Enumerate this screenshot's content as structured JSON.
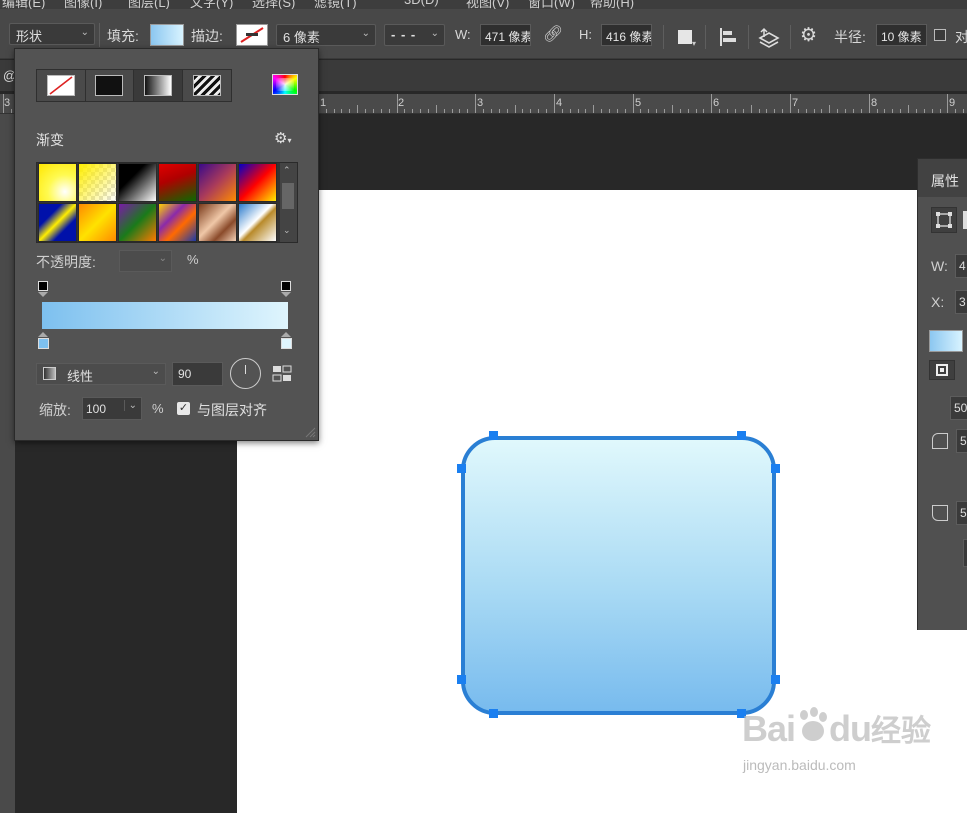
{
  "options_bar": {
    "tool_mode": "形状",
    "fill_label": "填充:",
    "stroke_label": "描边:",
    "stroke_width": "6 像素",
    "stroke_type": "- - -",
    "w_label": "W:",
    "w_value": "471 像素",
    "h_label": "H:",
    "h_value": "416 像素",
    "radius_label": "半径:",
    "radius_value": "10 像素",
    "align_edges_label": "对"
  },
  "document_tab": "@",
  "ruler": {
    "numbers": [
      "1",
      "2",
      "3",
      "4",
      "5",
      "6",
      "7",
      "8",
      "9"
    ],
    "left_number": "3"
  },
  "gradient_popup": {
    "section_title": "渐变",
    "opacity_label": "不透明度:",
    "opacity_value": "",
    "opacity_unit": "%",
    "style_value": "线性",
    "angle_value": "90",
    "scale_label": "缩放:",
    "scale_value": "100",
    "scale_unit": "%",
    "align_layer_label": "与图层对齐",
    "align_layer_checked": true,
    "gradient_start_color": "#7dc0ef",
    "gradient_end_color": "#dff5fd",
    "presets": [
      "yellow-white",
      "yellow-transparent",
      "black-white",
      "red-green",
      "violet-orange",
      "blue-red-yellow",
      "blue-yellow-blue",
      "orange-yellow-orange",
      "violet-green-orange",
      "yellow-violet-orange-blue",
      "copper",
      "chrome"
    ]
  },
  "properties_panel": {
    "title": "属性",
    "w_label": "W:",
    "w_value": "4",
    "x_label": "X:",
    "x_value": "3",
    "corner_value": "50",
    "corner_a": "5",
    "corner_b": "5"
  },
  "shape": {
    "stroke_color": "#2a7fd4",
    "fill_top": "#e0f8fc",
    "fill_bottom": "#78bbee"
  },
  "watermark": {
    "brand": "Bai",
    "brand_tail": "du",
    "chinese": "经验",
    "url": "jingyan.baidu.com"
  }
}
